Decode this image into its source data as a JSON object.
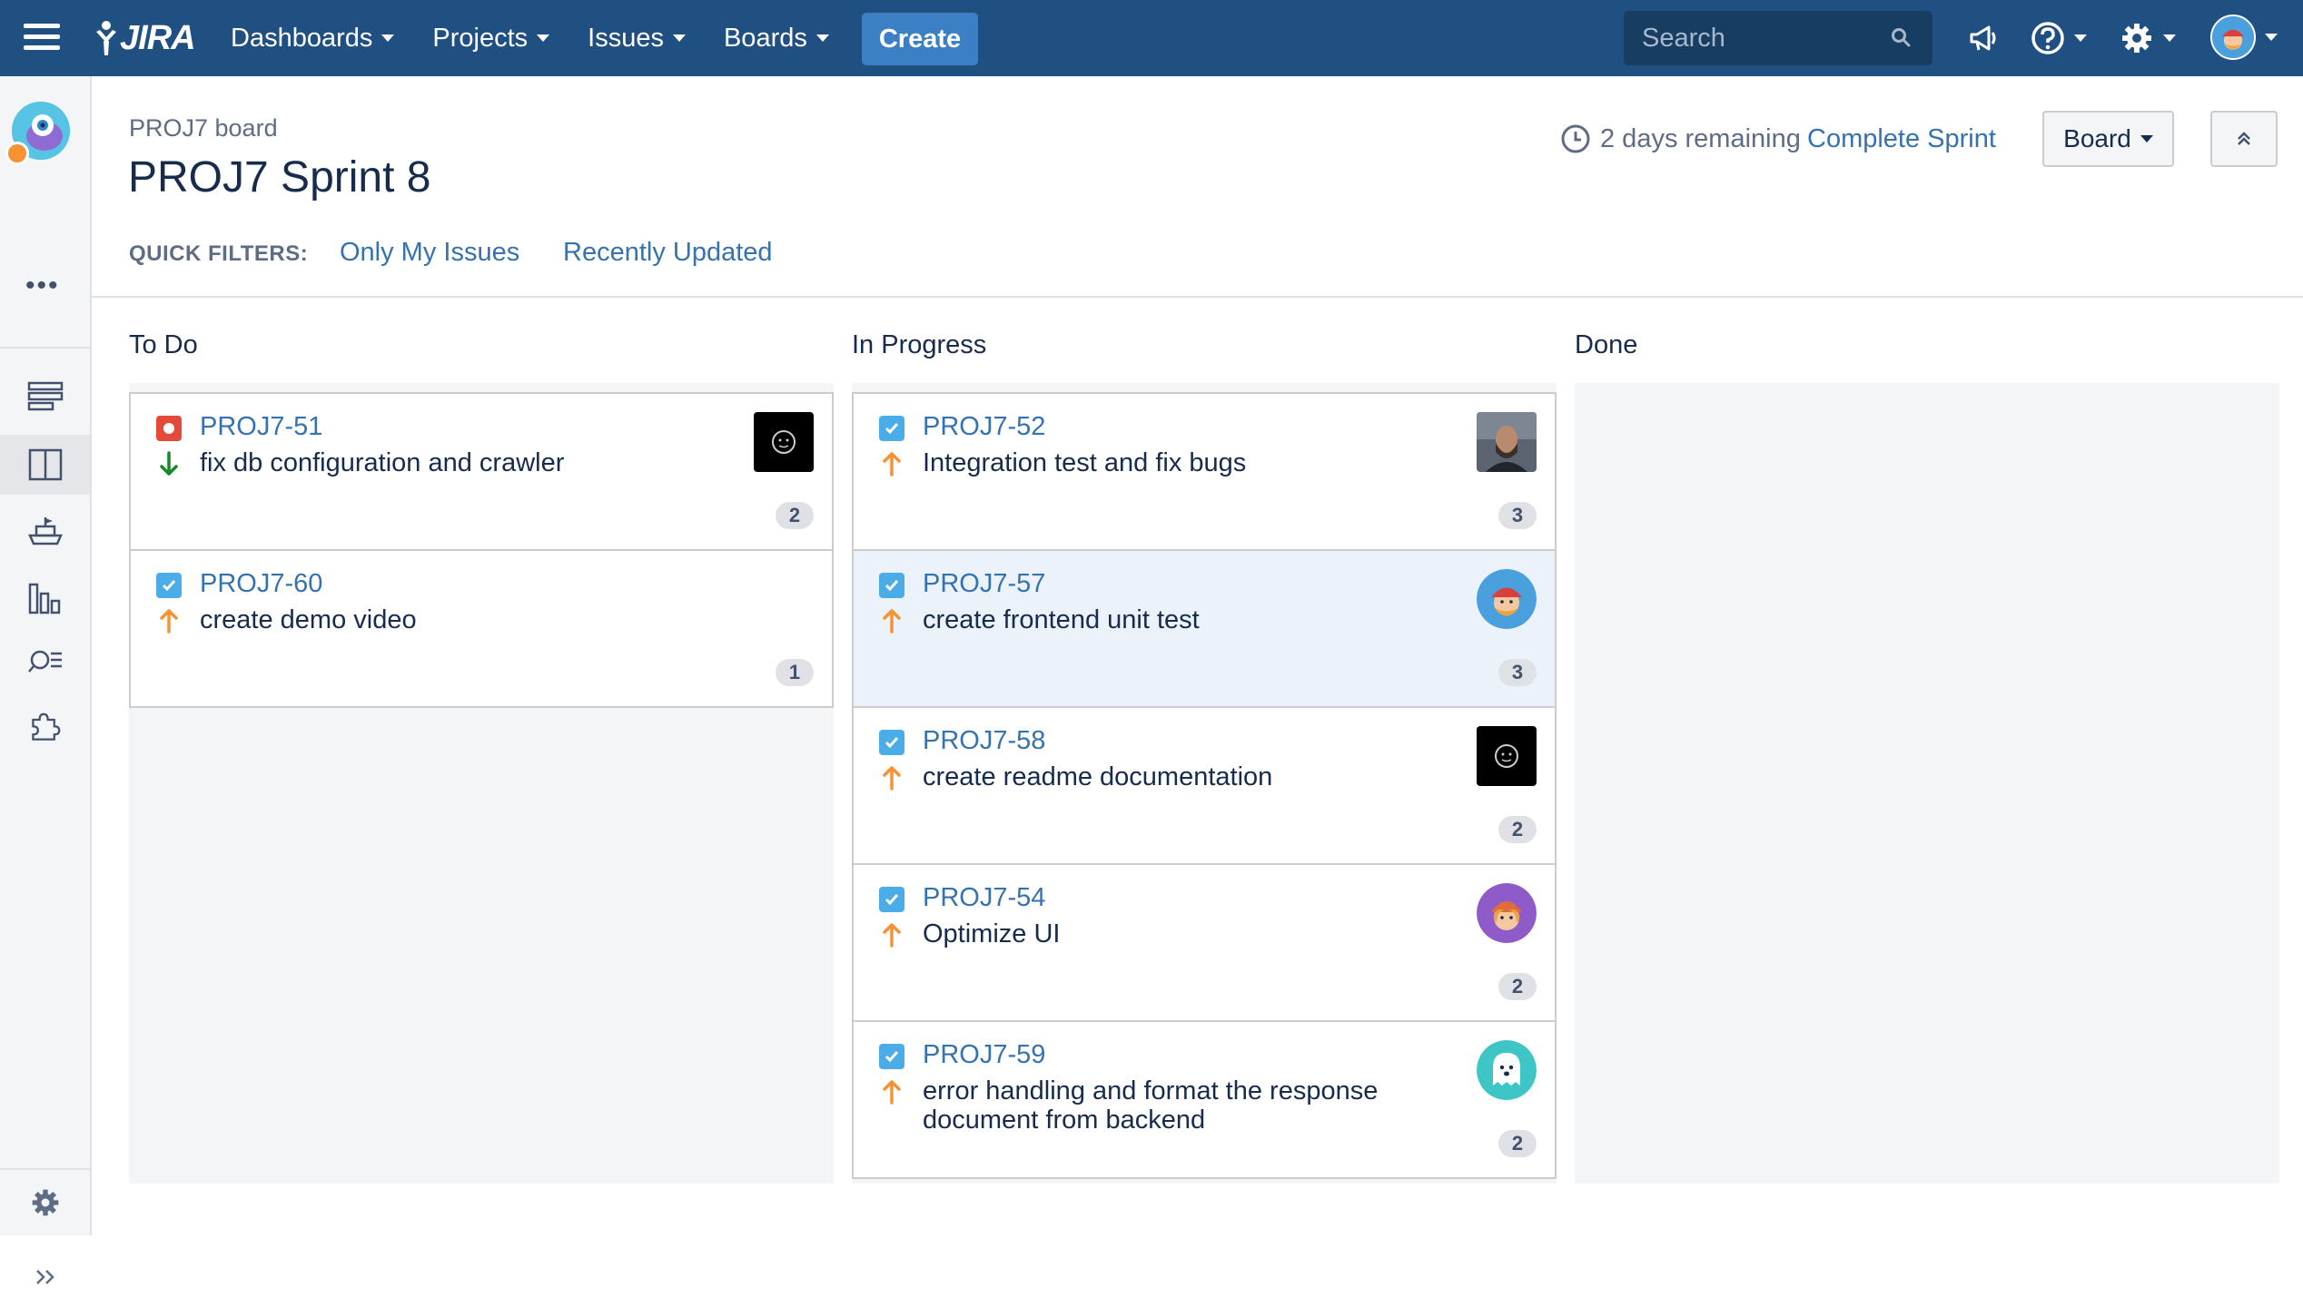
{
  "nav": {
    "logo": "JIRA",
    "items": [
      {
        "label": "Dashboards"
      },
      {
        "label": "Projects"
      },
      {
        "label": "Issues"
      },
      {
        "label": "Boards"
      }
    ],
    "create_label": "Create",
    "search_placeholder": "Search",
    "icons": [
      "megaphone-icon",
      "help-icon",
      "settings-icon"
    ]
  },
  "sidebar": {
    "items": [
      "backlog-icon",
      "active-sprints-icon",
      "releases-icon",
      "reports-icon",
      "issues-icon",
      "add-ons-icon"
    ],
    "footer": [
      "settings-icon",
      "expand-icon"
    ]
  },
  "header": {
    "board_name": "PROJ7 board",
    "sprint_title": "PROJ7 Sprint 8",
    "remaining": "2 days remaining",
    "complete_sprint": "Complete Sprint",
    "board_button": "Board",
    "quick_filters_label": "QUICK FILTERS:",
    "quick_filters": [
      "Only My Issues",
      "Recently Updated"
    ]
  },
  "columns": [
    {
      "title": "To Do",
      "cards": [
        {
          "key": "PROJ7-51",
          "summary": "fix db configuration and crawler",
          "type": "bug",
          "priority": "low",
          "estimate": "2",
          "avatar": "dark"
        },
        {
          "key": "PROJ7-60",
          "summary": "create demo video",
          "type": "task",
          "priority": "high",
          "estimate": "1",
          "avatar": "none"
        }
      ]
    },
    {
      "title": "In Progress",
      "cards": [
        {
          "key": "PROJ7-52",
          "summary": "Integration test and fix bugs",
          "type": "task",
          "priority": "high",
          "estimate": "3",
          "avatar": "photo"
        },
        {
          "key": "PROJ7-57",
          "summary": "create frontend unit test",
          "type": "task",
          "priority": "high",
          "estimate": "3",
          "avatar": "elf-blue"
        },
        {
          "key": "PROJ7-58",
          "summary": "create readme documentation",
          "type": "task",
          "priority": "high",
          "estimate": "2",
          "avatar": "dark"
        },
        {
          "key": "PROJ7-54",
          "summary": "Optimize UI",
          "type": "task",
          "priority": "high",
          "estimate": "2",
          "avatar": "elf-purple"
        },
        {
          "key": "PROJ7-59",
          "summary": "error handling and format the response document from backend",
          "type": "task",
          "priority": "high",
          "estimate": "2",
          "avatar": "ghost-teal"
        }
      ]
    },
    {
      "title": "Done",
      "cards": []
    }
  ],
  "colors": {
    "nav_bg": "#205081",
    "create_bg": "#3b7fc4",
    "link": "#3572b0",
    "priority_high": "#f79232",
    "priority_low": "#14892c",
    "bug": "#e5493a",
    "task": "#4bade8"
  }
}
